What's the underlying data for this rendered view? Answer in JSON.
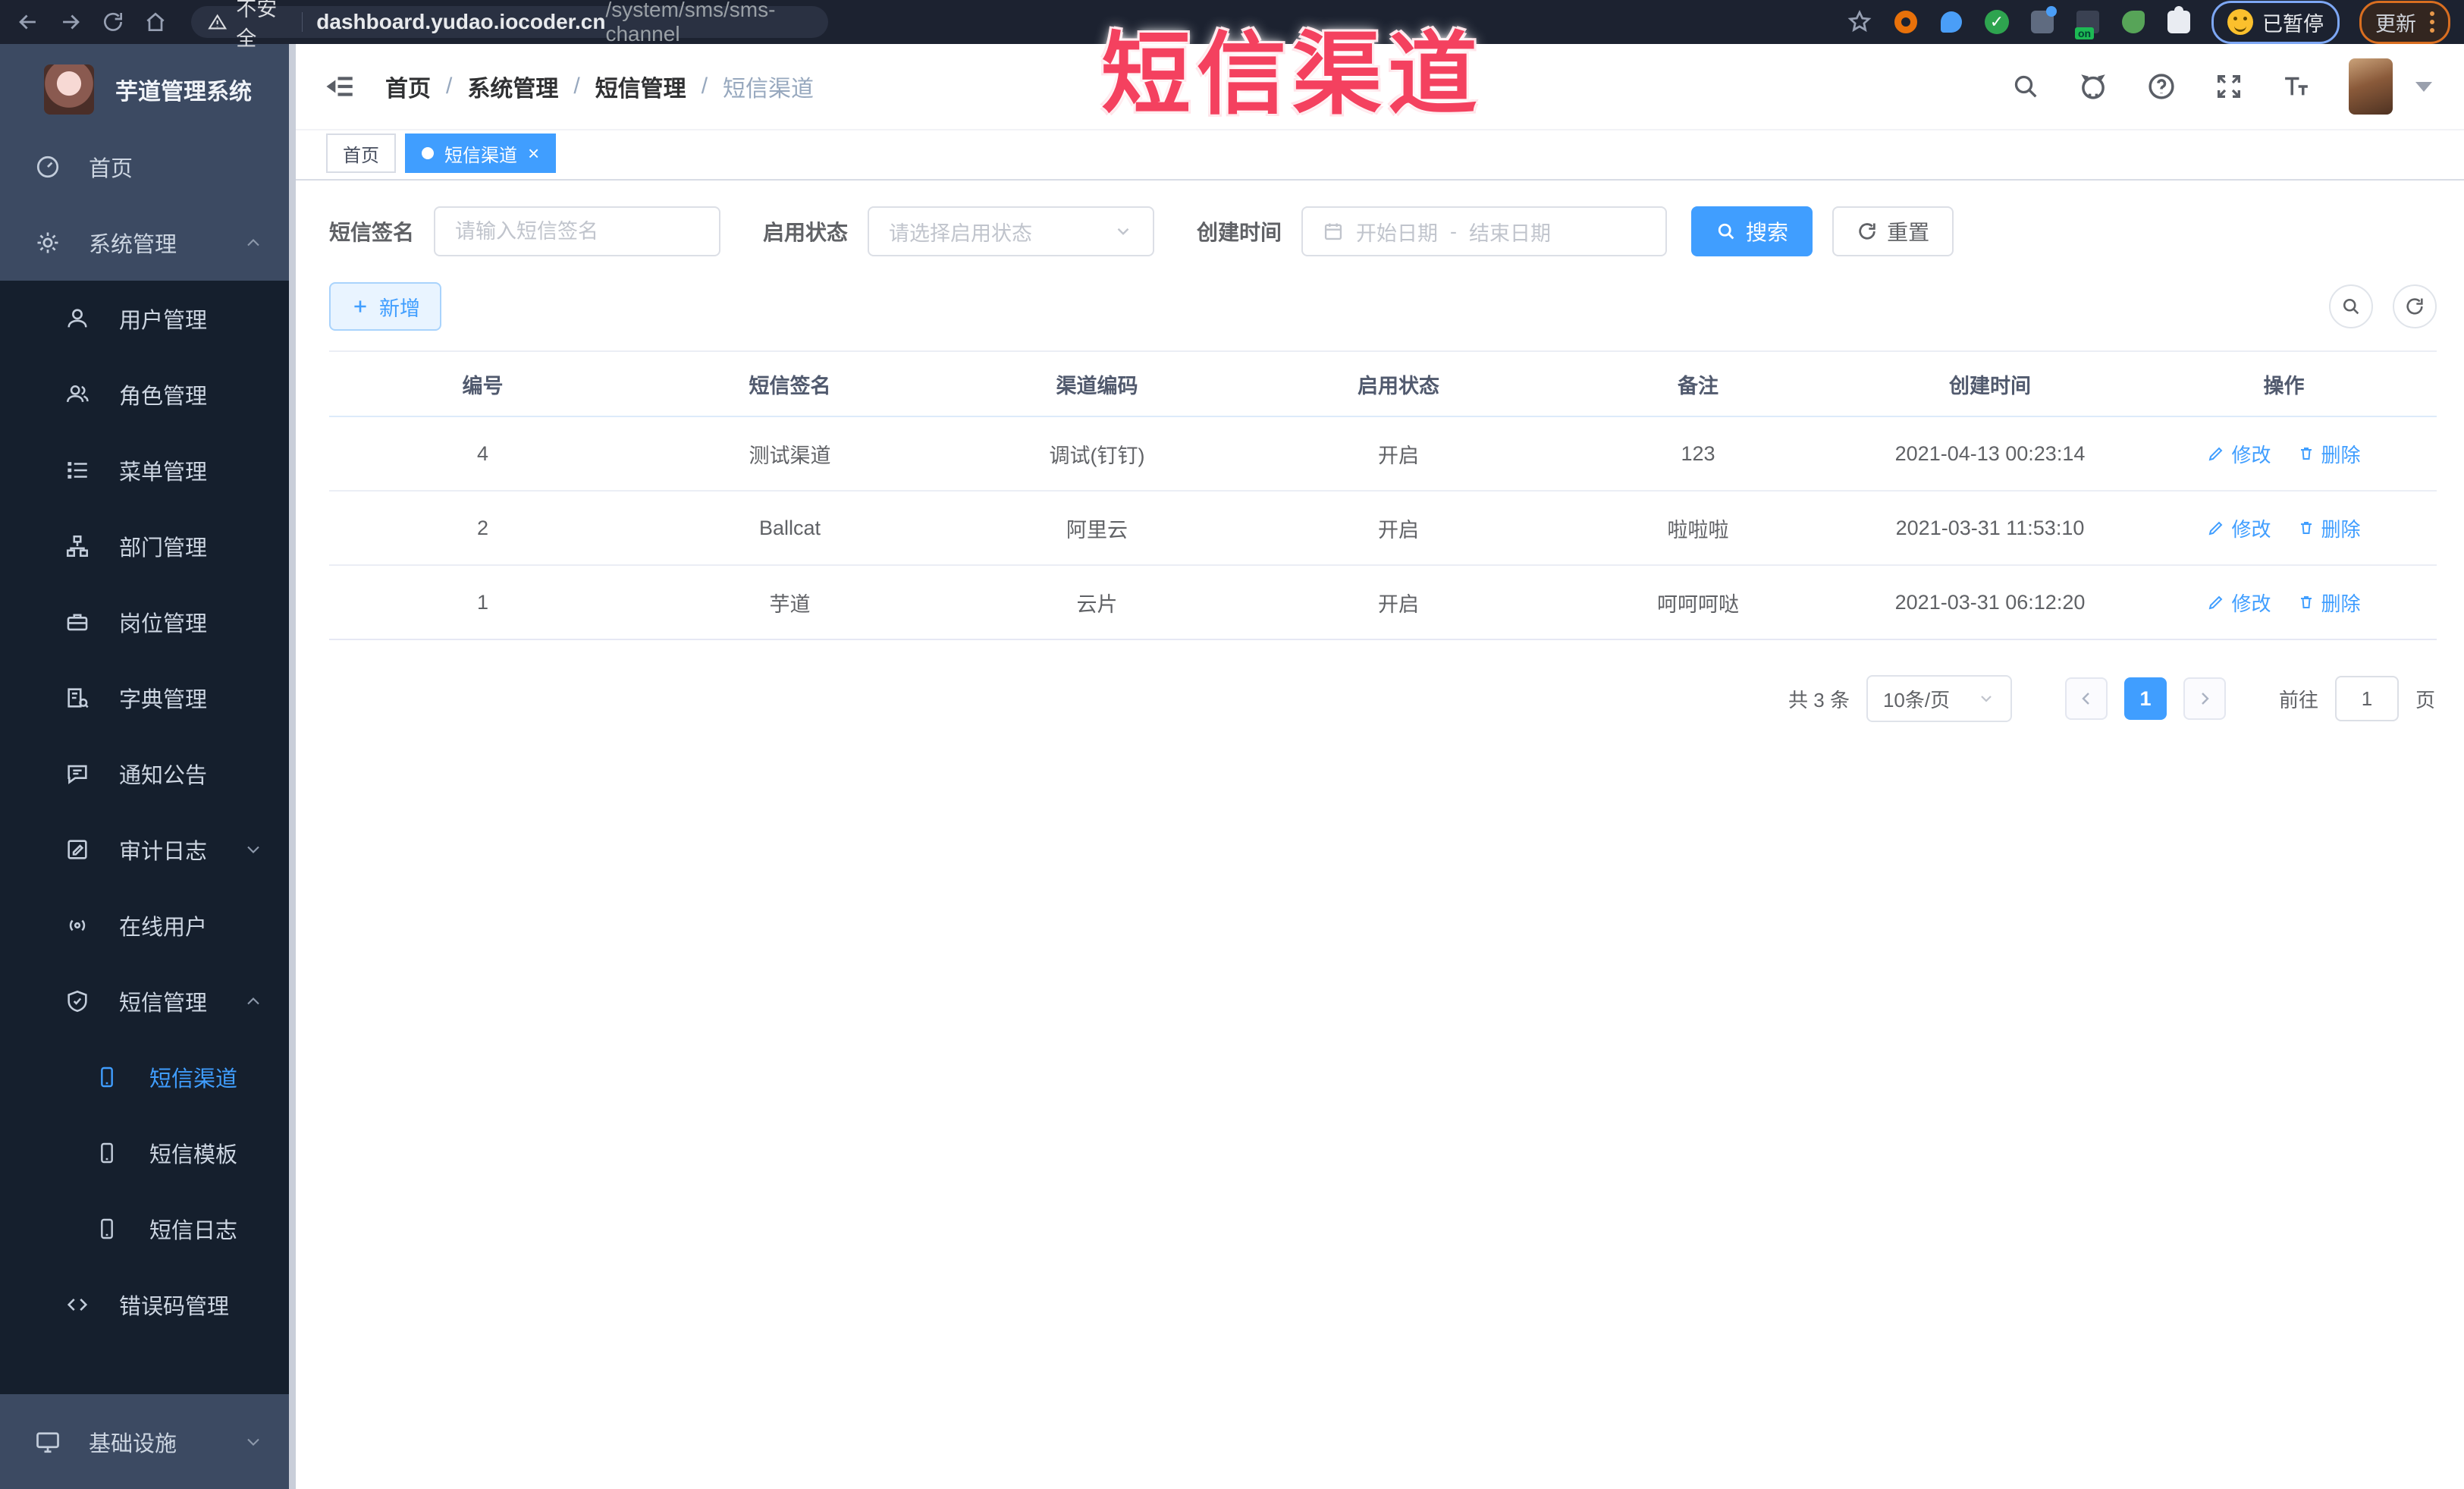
{
  "browser": {
    "security_label": "不安全",
    "url_host": "dashboard.yudao.iocoder.cn",
    "url_path": "/system/sms/sms-channel",
    "ext_on_label": "on",
    "paused_label": "已暂停",
    "update_label": "更新"
  },
  "watermark_text": "短信渠道",
  "sidebar": {
    "logo_title": "芋道管理系统",
    "items": [
      {
        "label": "首页"
      },
      {
        "label": "系统管理"
      },
      {
        "label": "用户管理"
      },
      {
        "label": "角色管理"
      },
      {
        "label": "菜单管理"
      },
      {
        "label": "部门管理"
      },
      {
        "label": "岗位管理"
      },
      {
        "label": "字典管理"
      },
      {
        "label": "通知公告"
      },
      {
        "label": "审计日志"
      },
      {
        "label": "在线用户"
      },
      {
        "label": "短信管理"
      },
      {
        "label": "短信渠道"
      },
      {
        "label": "短信模板"
      },
      {
        "label": "短信日志"
      },
      {
        "label": "错误码管理"
      },
      {
        "label": "基础设施"
      }
    ]
  },
  "header": {
    "breadcrumb": [
      "首页",
      "系统管理",
      "短信管理",
      "短信渠道"
    ],
    "breadcrumb_separator": "/"
  },
  "tabs": {
    "items": [
      {
        "label": "首页"
      },
      {
        "label": "短信渠道"
      }
    ],
    "close_glyph": "×"
  },
  "filter": {
    "sign_label": "短信签名",
    "sign_placeholder": "请输入短信签名",
    "status_label": "启用状态",
    "status_placeholder": "请选择启用状态",
    "time_label": "创建时间",
    "start_placeholder": "开始日期",
    "range_separator": "-",
    "end_placeholder": "结束日期",
    "search_label": "搜索",
    "reset_label": "重置"
  },
  "toolbar": {
    "add_label": "新增"
  },
  "table": {
    "headers": [
      "编号",
      "短信签名",
      "渠道编码",
      "启用状态",
      "备注",
      "创建时间",
      "操作"
    ],
    "rows": [
      {
        "id": "4",
        "sign": "测试渠道",
        "code": "调试(钉钉)",
        "status": "开启",
        "remark": "123",
        "created": "2021-04-13 00:23:14",
        "edit": "修改",
        "delete": "删除"
      },
      {
        "id": "2",
        "sign": "Ballcat",
        "code": "阿里云",
        "status": "开启",
        "remark": "啦啦啦",
        "created": "2021-03-31 11:53:10",
        "edit": "修改",
        "delete": "删除"
      },
      {
        "id": "1",
        "sign": "芋道",
        "code": "云片",
        "status": "开启",
        "remark": "呵呵呵哒",
        "created": "2021-03-31 06:12:20",
        "edit": "修改",
        "delete": "删除"
      }
    ]
  },
  "pagination": {
    "total_label": "共 3 条",
    "page_size_label": "10条/页",
    "current_page": "1",
    "goto_label": "前往",
    "goto_value": "1",
    "unit_label": "页"
  },
  "colors": {
    "accent": "#409eff",
    "watermark": "#f4415f",
    "sidebar_top": "#3c4a62",
    "sidebar_dark": "#151f2d"
  }
}
